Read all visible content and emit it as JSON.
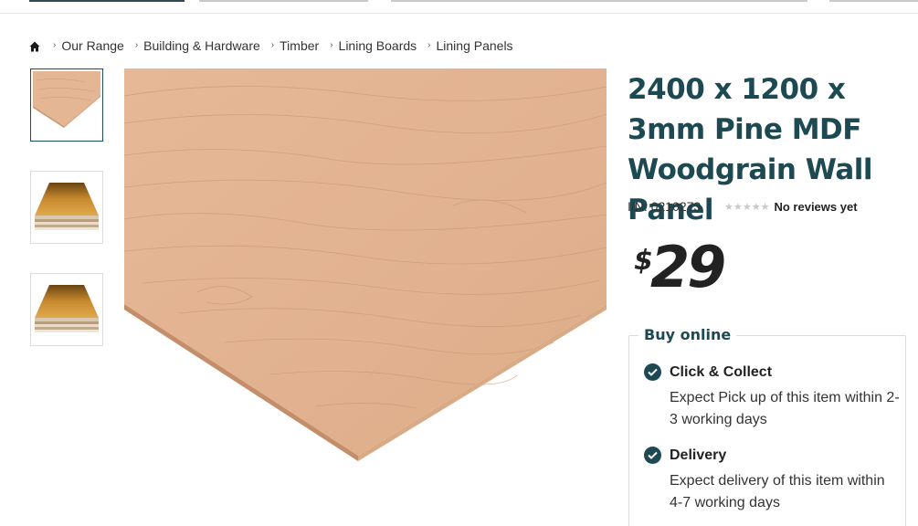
{
  "breadcrumb": {
    "home_icon": "home-icon",
    "items": [
      "Our Range",
      "Building & Hardware",
      "Timber",
      "Lining Boards",
      "Lining Panels"
    ]
  },
  "product": {
    "title": "2400 x 1200 x 3mm Pine MDF Woodgrain Wall Panel",
    "item_number": "I/N: 0210273",
    "rating_stars": 0,
    "reviews_text": "No reviews yet",
    "price_currency": "$",
    "price_amount": "29"
  },
  "buy_online": {
    "title": "Buy online",
    "options": [
      {
        "name": "Click & Collect",
        "description": "Expect Pick up of this item within 2-3 working days"
      },
      {
        "name": "Delivery",
        "description": "Expect delivery of this item within 4-7 working days"
      }
    ]
  },
  "colors": {
    "brand": "#1d4a52",
    "wood": "#e3b592",
    "wood_edge": "#cf9d78"
  },
  "thumbnails": [
    "wood-panel-image",
    "stacked-boards-image",
    "stacked-boards-image"
  ]
}
